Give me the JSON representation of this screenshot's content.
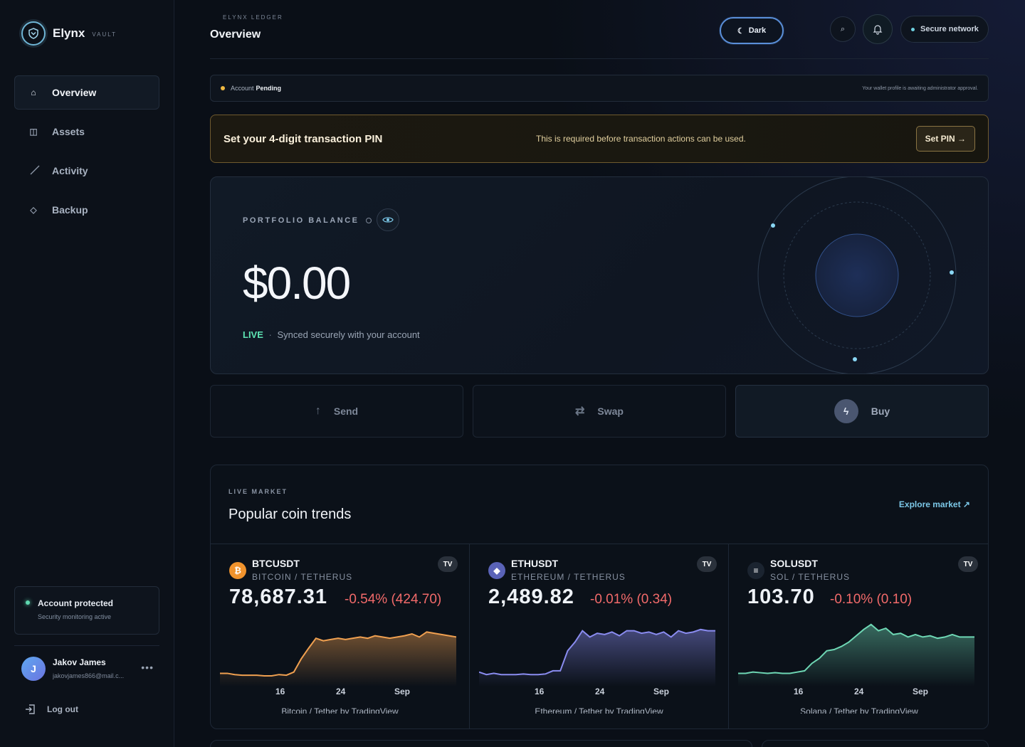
{
  "brand": {
    "name": "Elynx",
    "sub": "VAULT"
  },
  "nav": [
    {
      "label": "Overview",
      "icon": "home-icon",
      "active": true
    },
    {
      "label": "Assets",
      "icon": "grid-icon",
      "active": false
    },
    {
      "label": "Activity",
      "icon": "trend-icon",
      "active": false
    },
    {
      "label": "Backup",
      "icon": "diamond-icon",
      "active": false
    }
  ],
  "protect": {
    "title": "Account protected",
    "subtitle": "Security monitoring active"
  },
  "user": {
    "initial": "J",
    "name": "Jakov James",
    "email": "jakovjames866@mail.c...",
    "more": "•••"
  },
  "logout_label": "Log out",
  "header": {
    "crumb": "ELYNX LEDGER",
    "title": "Overview",
    "theme_label": "Dark",
    "network_label": "Secure network"
  },
  "status": {
    "label": "Account",
    "value": "Pending",
    "message": "Your wallet profile is awaiting administrator approval."
  },
  "pin_banner": {
    "title": "Set your 4-digit transaction PIN",
    "message": "This is required before transaction actions can be used.",
    "button": "Set PIN →"
  },
  "portfolio": {
    "label": "PORTFOLIO BALANCE",
    "amount": "$0.00",
    "live": "LIVE",
    "sep": "·",
    "live_text": "Synced securely with your account"
  },
  "actions": {
    "send": "Send",
    "swap": "Swap",
    "buy": "Buy"
  },
  "market": {
    "kicker": "LIVE MARKET",
    "title": "Popular coin trends",
    "link": "Explore market ↗",
    "ticks": [
      "16",
      "24",
      "Sep"
    ],
    "coins": [
      {
        "symbol": "BTCUSDT",
        "name": "BITCOIN / TETHERUS",
        "price": "78,687.31",
        "change": "-0.54% (424.70)",
        "footer": "Bitcoin / Tether by TradingView",
        "color": "#f0a050",
        "icon_bg": "#f0932d",
        "icon_glyph": "₿",
        "chart_data": {
          "type": "area",
          "x": [
            "",
            "",
            "",
            "",
            "",
            "",
            "",
            "",
            "16",
            "",
            "",
            "",
            "",
            "",
            "",
            "",
            "",
            "",
            "",
            "24",
            "",
            "",
            "",
            "",
            "",
            "",
            "",
            "",
            "",
            "",
            "Sep",
            "",
            ""
          ],
          "series": [
            {
              "values": [
                12,
                12,
                10,
                9,
                9,
                9,
                8,
                8,
                10,
                9,
                14,
                35,
                52,
                68,
                64,
                66,
                68,
                66,
                68,
                70,
                68,
                72,
                70,
                68,
                70,
                72,
                75,
                70,
                78,
                76,
                74,
                72,
                70
              ]
            }
          ],
          "ylim": [
            0,
            100
          ]
        }
      },
      {
        "symbol": "ETHUSDT",
        "name": "ETHEREUM / TETHERUS",
        "price": "2,489.82",
        "change": "-0.01% (0.34)",
        "footer": "Ethereum / Tether by TradingView",
        "color": "#8a8cf0",
        "icon_bg": "#5a63b8",
        "icon_glyph": "◆",
        "chart_data": {
          "type": "area",
          "x": [
            "",
            "",
            "",
            "",
            "",
            "",
            "",
            "",
            "16",
            "",
            "",
            "",
            "",
            "",
            "",
            "",
            "",
            "",
            "",
            "24",
            "",
            "",
            "",
            "",
            "",
            "",
            "",
            "",
            "",
            "",
            "Sep",
            "",
            ""
          ],
          "series": [
            {
              "values": [
                14,
                10,
                12,
                10,
                10,
                10,
                11,
                10,
                10,
                11,
                16,
                16,
                48,
                62,
                80,
                70,
                76,
                74,
                78,
                72,
                80,
                80,
                76,
                78,
                74,
                78,
                70,
                80,
                76,
                78,
                82,
                80,
                80
              ]
            }
          ],
          "ylim": [
            0,
            100
          ]
        }
      },
      {
        "symbol": "SOLUSDT",
        "name": "SOL / TETHERUS",
        "price": "103.70",
        "change": "-0.10% (0.10)",
        "footer": "Solana / Tether by TradingView",
        "color": "#6ed7b4",
        "icon_bg": "#1b2430",
        "icon_glyph": "≡",
        "chart_data": {
          "type": "area",
          "x": [
            "",
            "",
            "",
            "",
            "",
            "",
            "",
            "",
            "16",
            "",
            "",
            "",
            "",
            "",
            "",
            "",
            "",
            "",
            "",
            "24",
            "",
            "",
            "",
            "",
            "",
            "",
            "",
            "",
            "",
            "",
            "Sep",
            "",
            ""
          ],
          "series": [
            {
              "values": [
                12,
                12,
                14,
                13,
                12,
                13,
                12,
                12,
                14,
                16,
                28,
                36,
                48,
                50,
                55,
                62,
                72,
                82,
                90,
                80,
                84,
                74,
                76,
                70,
                74,
                70,
                72,
                68,
                70,
                74,
                70,
                70,
                70
              ]
            }
          ],
          "ylim": [
            0,
            100
          ]
        }
      }
    ]
  },
  "colors": {
    "accent": "#7cc8e8",
    "live": "#5de3b3",
    "negative": "#f26a6a",
    "warning": "#f0b942"
  }
}
